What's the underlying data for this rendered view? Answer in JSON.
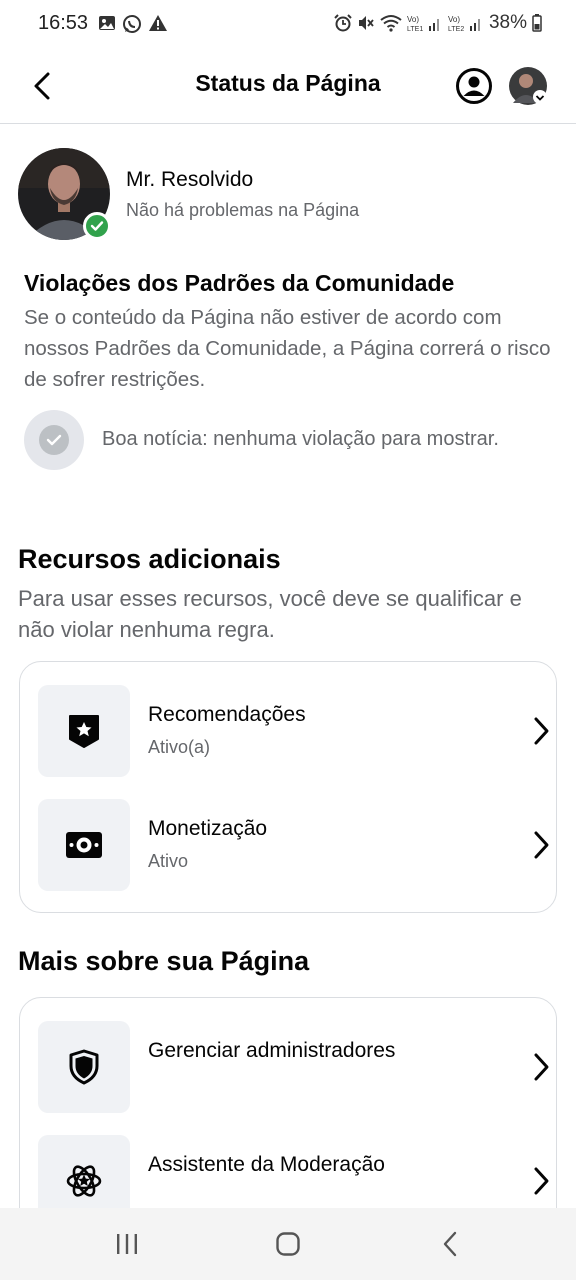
{
  "status_bar": {
    "time": "16:53",
    "battery": "38%",
    "left_icons": [
      "image-icon",
      "whatsapp-icon",
      "warning-icon"
    ],
    "right_icons": [
      "alarm-icon",
      "mute-icon",
      "wifi-icon",
      "signal-lte1-icon",
      "signal-lte2-icon",
      "battery-icon"
    ]
  },
  "header": {
    "title": "Status da Página",
    "back_icon": "back-arrow-icon",
    "profile_icon": "profile-circle-icon"
  },
  "page": {
    "name": "Mr. Resolvido",
    "status": "Não há problemas na Página"
  },
  "violations": {
    "title": "Violações dos Padrões da Comunidade",
    "description": "Se o conteúdo da Página não estiver de acordo com nossos Padrões da Comunidade, a Página correrá o risco de sofrer restrições.",
    "good_news": "Boa notícia: nenhuma violação para mostrar."
  },
  "resources": {
    "title": "Recursos adicionais",
    "description": "Para usar esses recursos, você deve se qualificar e não violar nenhuma regra.",
    "items": [
      {
        "title": "Recomendações",
        "subtitle": "Ativo(a)",
        "icon": "badge-star-icon"
      },
      {
        "title": "Monetização",
        "subtitle": "Ativo",
        "icon": "money-icon"
      }
    ]
  },
  "more": {
    "title": "Mais sobre sua Página",
    "items": [
      {
        "title": "Gerenciar administradores",
        "icon": "shield-icon"
      },
      {
        "title": "Assistente da Moderação",
        "icon": "atom-star-icon"
      }
    ]
  },
  "nav": {
    "icons": [
      "recent-apps-icon",
      "home-icon",
      "back-icon"
    ]
  },
  "colors": {
    "accent_green": "#31a24c",
    "secondary_text": "#65676b",
    "icon_bg": "#f0f2f5"
  }
}
